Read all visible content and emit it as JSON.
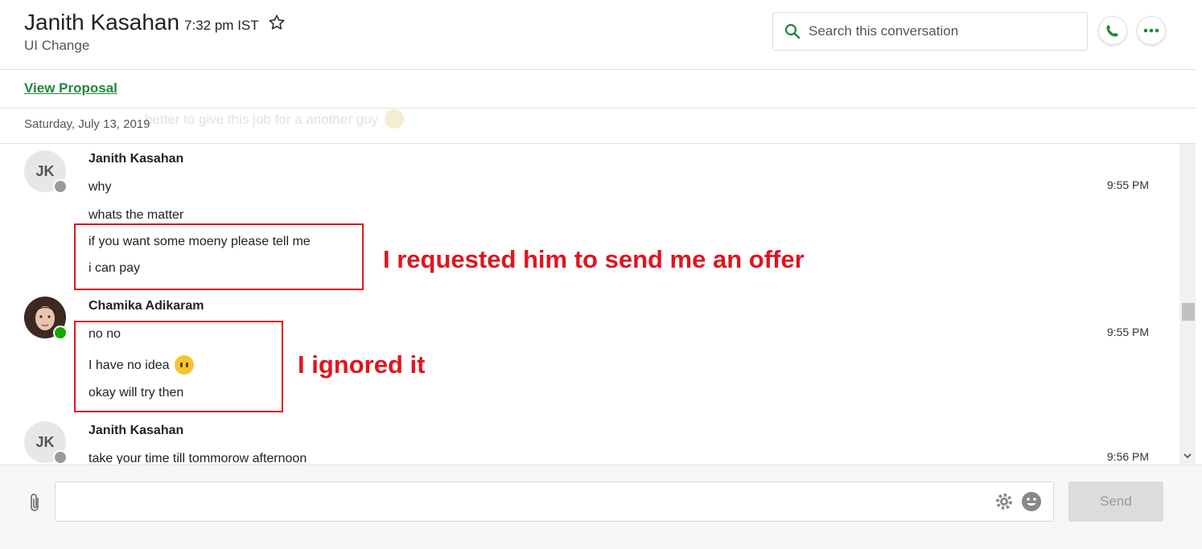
{
  "header": {
    "name": "Janith Kasahan",
    "local_time": "7:32 pm IST",
    "subtitle": "UI Change",
    "search_placeholder": "Search this conversation"
  },
  "proposal_link": "View Proposal",
  "date_divider": "Saturday, July 13, 2019",
  "ghost_text": "better to give this job for a another guy",
  "messages": [
    {
      "initials": "JK",
      "sender": "Janith Kasahan",
      "time": "9:55 PM",
      "lines": [
        "why",
        "whats the matter",
        "if you want some moeny please tell me",
        "i can pay"
      ]
    },
    {
      "initials": "",
      "sender": "Chamika Adikaram",
      "time": "9:55 PM",
      "lines": [
        "no no",
        "I have no idea",
        "okay will try then"
      ]
    },
    {
      "initials": "JK",
      "sender": "Janith Kasahan",
      "time": "9:56 PM",
      "lines": [
        "take your time till tommorow afternoon"
      ]
    }
  ],
  "annotations": {
    "first": "I requested him to send me an offer",
    "second": "I ignored it"
  },
  "composer": {
    "send_label": "Send"
  },
  "colors": {
    "accent_green": "#1f8a3a",
    "online_green": "#14a800",
    "annotation_red": "#e0141e"
  },
  "icons": [
    "star-icon",
    "search-icon",
    "phone-icon",
    "more-icon",
    "attach-icon",
    "gear-icon",
    "smiley-icon",
    "chevron-down-icon"
  ]
}
